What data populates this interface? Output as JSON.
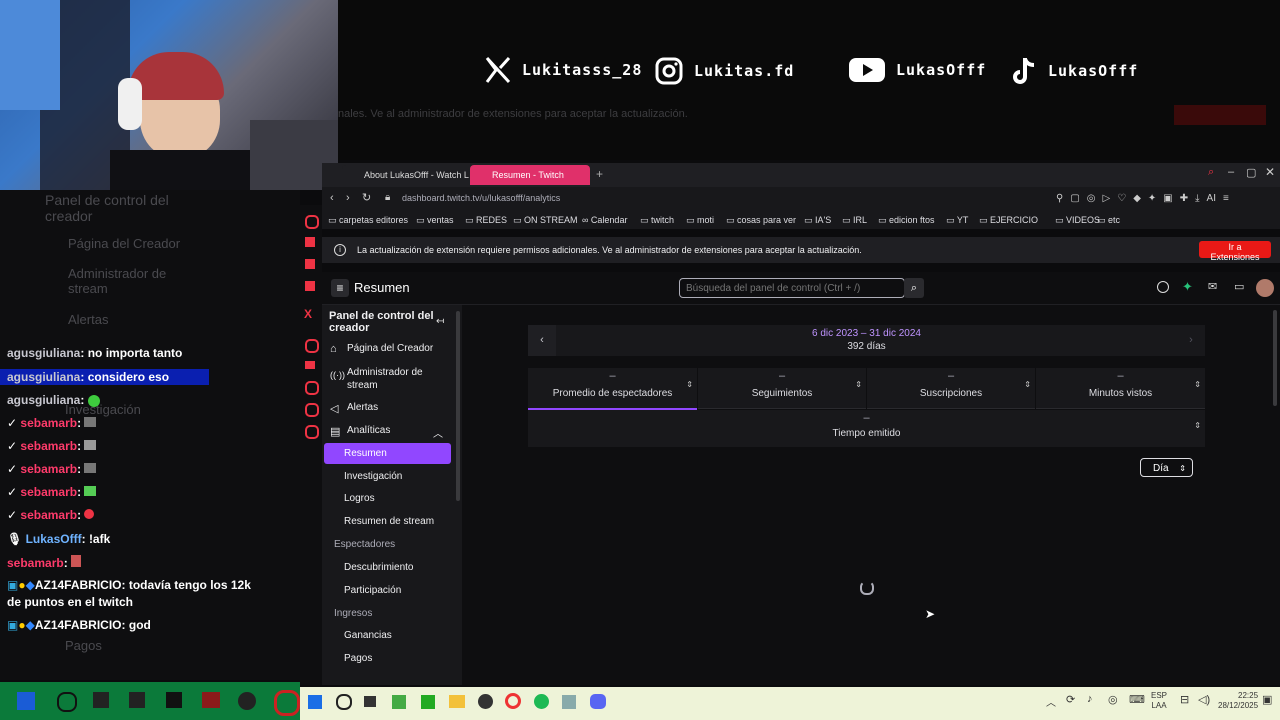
{
  "overlay": {
    "socials": [
      {
        "name": "x-icon",
        "handle": "Lukitasss_28"
      },
      {
        "name": "instagram-icon",
        "handle": "Lukitas.fd"
      },
      {
        "name": "youtube-icon",
        "handle": "LukasOfff"
      },
      {
        "name": "tiktok-icon",
        "handle": "LukasOfff"
      }
    ],
    "ghost_notice": "nales. Ve al administrador de extensiones para aceptar la actualización."
  },
  "ghost_dashboard": {
    "title": "Panel de control del creador",
    "items": [
      "Página del Creador",
      "Administrador de stream",
      "Alertas",
      "Analíticas",
      "Investigación",
      "Logros",
      "Resumen de stream",
      "Descubrimiento",
      "Participación",
      "Pagos"
    ]
  },
  "chat": [
    {
      "user": "agusgiuliana",
      "msg": "no importa tanto",
      "color": "#c8c8d0"
    },
    {
      "user": "agusgiuliana",
      "msg": "considero eso",
      "color": "#c8c8d0"
    },
    {
      "user": "agusgiuliana",
      "msg": "",
      "color": "#c8c8d0"
    },
    {
      "user": "sebamarb",
      "msg": "",
      "color": "#ff3b6b"
    },
    {
      "user": "sebamarb",
      "msg": "",
      "color": "#ff3b6b"
    },
    {
      "user": "sebamarb",
      "msg": "",
      "color": "#ff3b6b"
    },
    {
      "user": "sebamarb",
      "msg": "",
      "color": "#ff3b6b"
    },
    {
      "user": "sebamarb",
      "msg": "",
      "color": "#ff3b6b"
    },
    {
      "user": "LukasOfff",
      "msg": "!afk",
      "color": "#6fb3ff"
    },
    {
      "user": "sebamarb",
      "msg": "",
      "color": "#ff3b6b"
    },
    {
      "user": "AZ14FABRICIO",
      "msg": "todavía tengo los 12k",
      "msg2": "de puntos en el twitch",
      "color": "#ffffff"
    },
    {
      "user": "AZ14FABRICIO",
      "msg": "god",
      "color": "#ffffff"
    }
  ],
  "browser": {
    "tabs": [
      {
        "label": "About LukasOfff - Watch L",
        "active": false
      },
      {
        "label": "Resumen - Twitch",
        "active": true
      }
    ],
    "url": "dashboard.twitch.tv/u/lukasofff/analytics",
    "bookmarks": [
      "carpetas editores",
      "ventas",
      "REDES",
      "ON STREAM",
      "Calendar",
      "twitch",
      "moti",
      "cosas para ver",
      "IA'S",
      "IRL",
      "edicion ftos",
      "YT",
      "EJERCICIO",
      "VIDEOS",
      "etc"
    ],
    "notice_text": "La actualización de extensión requiere permisos adicionales. Ve al administrador de extensiones para aceptar la actualización.",
    "notice_button": "Ir a Extensiones"
  },
  "twitch": {
    "page_title": "Resumen",
    "search_placeholder": "Búsqueda del panel de control (Ctrl + /)",
    "sidebar": {
      "title": "Panel de control del creador",
      "items": [
        {
          "label": "Página del Creador"
        },
        {
          "label": "Administrador de stream"
        },
        {
          "label": "Alertas"
        },
        {
          "label": "Analíticas"
        }
      ],
      "analytics_sub": [
        "Resumen",
        "Investigación",
        "Logros",
        "Resumen de stream"
      ],
      "sections": [
        {
          "title": "Espectadores",
          "items": [
            "Descubrimiento",
            "Participación"
          ]
        },
        {
          "title": "Ingresos",
          "items": [
            "Ganancias",
            "Pagos"
          ]
        }
      ],
      "active": "Resumen"
    },
    "date_range": "6 dic 2023 – 31 dic 2024",
    "days": "392 días",
    "metrics": [
      {
        "label": "Promedio de espectadores",
        "value": "–"
      },
      {
        "label": "Seguimientos",
        "value": "–"
      },
      {
        "label": "Suscripciones",
        "value": "–"
      },
      {
        "label": "Minutos vistos",
        "value": "–"
      },
      {
        "label": "Tiempo emitido",
        "value": "–"
      }
    ],
    "granularity": "Día"
  },
  "taskbar": {
    "lang_top": "ESP",
    "lang_bottom": "LAA",
    "time": "22:25",
    "date": "28/12/2025"
  },
  "colors": {
    "accent": "#9147ff",
    "notice_button": "#e91916",
    "taskbar": "#eef3d8"
  }
}
